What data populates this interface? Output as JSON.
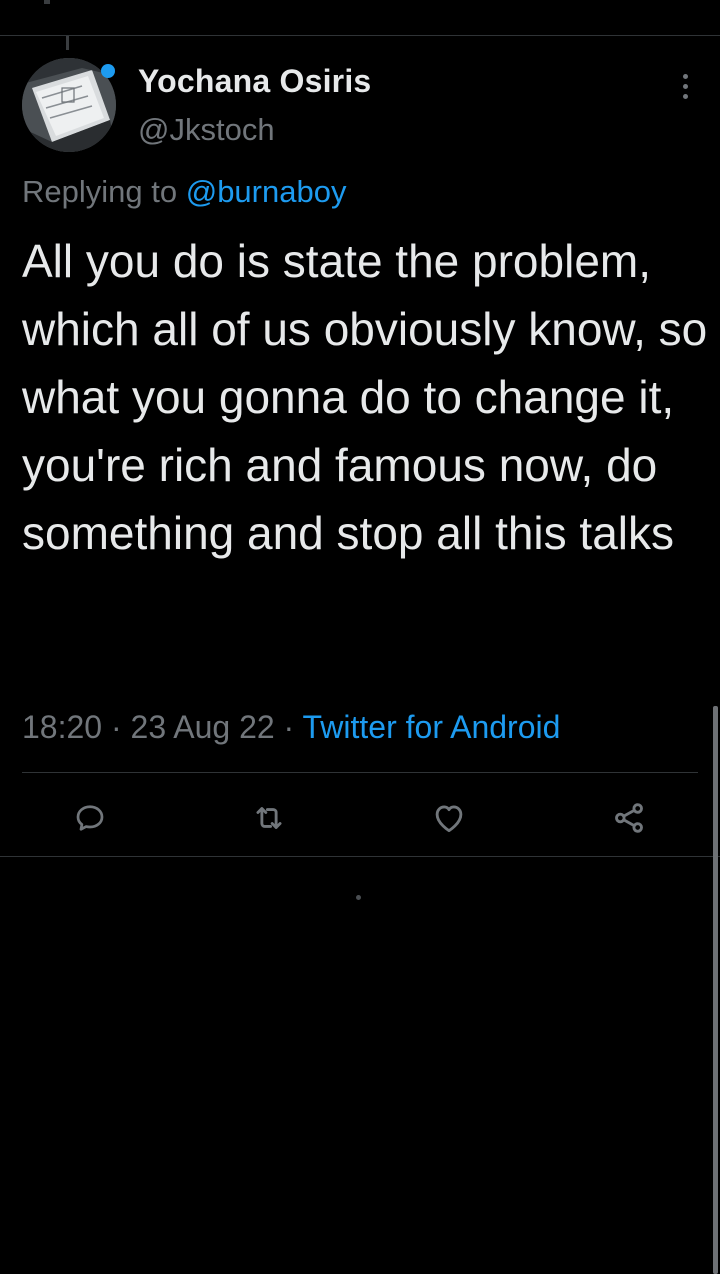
{
  "tweet": {
    "display_name": "Yochana Osiris",
    "handle": "@Jkstoch",
    "replying_prefix": "Replying to ",
    "replying_to": "@burnaboy",
    "text": "All you do is state the problem, which all of us obviously know, so what you gonna do to change it, you're rich and famous now, do something and stop all this talks",
    "time": "18:20",
    "date": "23 Aug 22",
    "source": "Twitter for Android",
    "separator": " · "
  },
  "actions": [
    {
      "name": "reply-icon"
    },
    {
      "name": "retweet-icon"
    },
    {
      "name": "like-icon"
    },
    {
      "name": "share-icon"
    }
  ],
  "colors": {
    "background": "#000000",
    "text": "#e7e9ea",
    "secondary": "#71767b",
    "accent": "#1d9bf0",
    "divider": "#2f3336"
  }
}
